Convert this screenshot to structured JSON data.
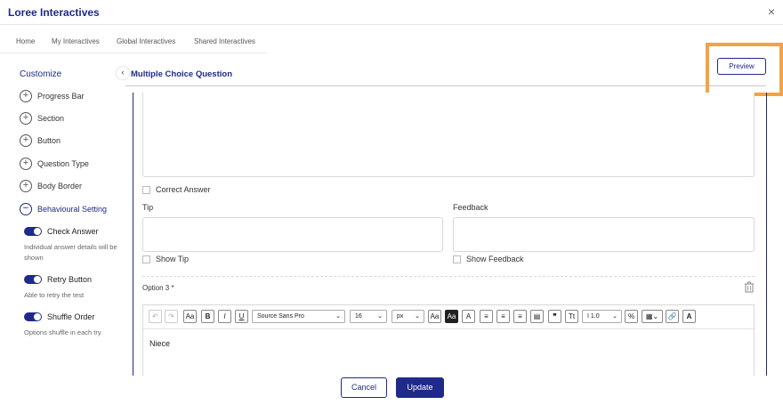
{
  "app": {
    "title": "Loree Interactives",
    "close_symbol": "×"
  },
  "nav": {
    "tabs": [
      "Home",
      "My Interactives",
      "Global Interactives",
      "Shared Interactives"
    ]
  },
  "sidebar": {
    "title": "Customize",
    "collapse_symbol": "‹",
    "items": [
      {
        "label": "Progress Bar",
        "icon": "plus-circle-icon"
      },
      {
        "label": "Section",
        "icon": "plus-circle-icon"
      },
      {
        "label": "Button",
        "icon": "plus-circle-icon"
      },
      {
        "label": "Question Type",
        "icon": "plus-circle-icon"
      },
      {
        "label": "Body Border",
        "icon": "plus-circle-icon"
      },
      {
        "label": "Behavioural Setting",
        "icon": "minus-circle-icon"
      }
    ],
    "toggles": [
      {
        "label": "Check Answer",
        "description": "Individual answer details will be shown",
        "on": true
      },
      {
        "label": "Retry Button",
        "description": "Able to retry the test",
        "on": true
      },
      {
        "label": "Shuffle Order",
        "description": "Options shuffle in each try",
        "on": true
      }
    ]
  },
  "main": {
    "title": "Multiple Choice Question",
    "preview_label": "Preview",
    "correct_answer_label": "Correct Answer",
    "tip_label": "Tip",
    "feedback_label": "Feedback",
    "show_tip_label": "Show Tip",
    "show_feedback_label": "Show Feedback",
    "option_label": "Option 3 *",
    "editor": {
      "font_family": "Source Sans Pro",
      "font_size": "16",
      "unit": "px",
      "line_height": "1.0",
      "content": "Niece"
    }
  },
  "footer": {
    "cancel_label": "Cancel",
    "update_label": "Update"
  },
  "colors": {
    "brand": "#1f2a8a",
    "highlight": "#f5a242"
  }
}
